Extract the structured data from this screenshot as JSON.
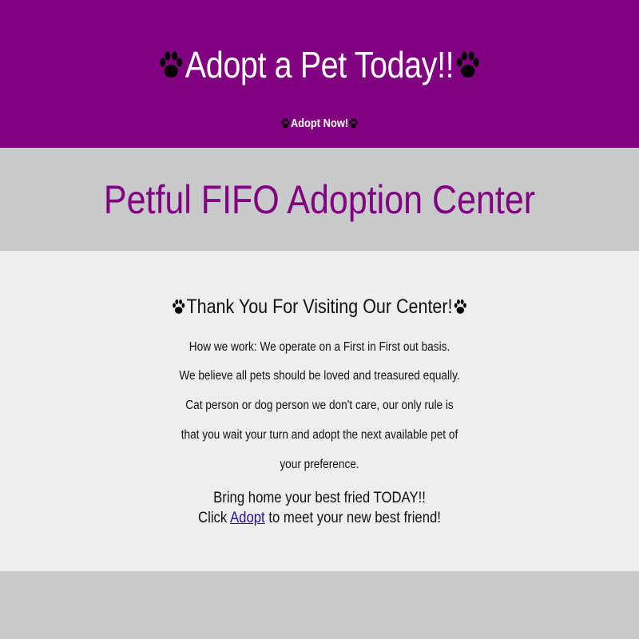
{
  "header": {
    "title": "Adopt a Pet Today!!",
    "cta_label": "Adopt Now!",
    "background_color": "#800080",
    "icon": "paw-icon"
  },
  "center": {
    "name": "Petful FIFO Adoption Center",
    "name_color": "#800080"
  },
  "main": {
    "heading": "Thank You For Visiting Our Center!",
    "paragraphs": [
      "How we work: We operate on a First in First out basis.",
      "We believe all pets should be loved and treasured equally.",
      "Cat person or dog person we don't care, our only rule is",
      "that you wait your turn and adopt the next available pet of",
      "your preference."
    ],
    "closing_line_1": "Bring home your best fried TODAY!!",
    "closing_prefix": "Click",
    "closing_link": "Adopt",
    "closing_suffix": "to meet your new best friend!"
  }
}
